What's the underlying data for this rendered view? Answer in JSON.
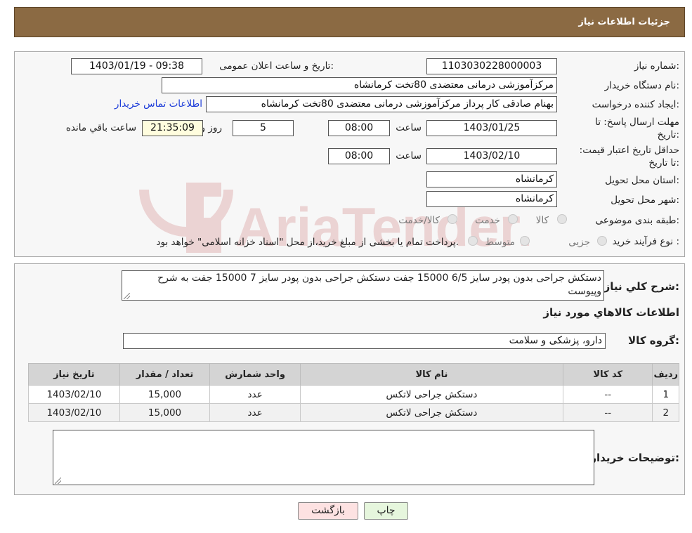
{
  "header": {
    "title": "جزئیات اطلاعات نیاز"
  },
  "watermark": {
    "text": "AriaTender.neT",
    "color": "#b02020"
  },
  "form": {
    "need_number": {
      "label": "شماره نیاز:",
      "value": "1103030228000003"
    },
    "announce": {
      "label": "تاریخ و ساعت اعلان عمومی:",
      "value": "1403/01/19 - 09:38"
    },
    "buyer_org": {
      "label": "نام دستگاه خریدار:",
      "value": "مرکزآموزشی درمانی معتضدی 80تخت کرمانشاه"
    },
    "requester": {
      "label": "ایجاد کننده درخواست:",
      "value": "بهنام صادقی کار پرداز مرکزآموزشی درمانی معتضدی 80تخت کرمانشاه",
      "contact_link": "اطلاعات تماس خریدار"
    },
    "deadline": {
      "label": "مهلت ارسال پاسخ: تا تاریخ:",
      "date": "1403/01/25",
      "time_label": "ساعت",
      "time": "08:00",
      "days": "5",
      "days_label": "روز و",
      "remaining": "21:35:09",
      "remaining_label": "ساعت باقي مانده"
    },
    "validity": {
      "label": "حداقل تاریخ اعتبار قیمت: تا تاریخ:",
      "date": "1403/02/10",
      "time_label": "ساعت",
      "time": "08:00"
    },
    "province": {
      "label": "استان محل تحویل:",
      "value": "کرمانشاه"
    },
    "city": {
      "label": "شهر محل تحویل:",
      "value": "کرمانشاه"
    },
    "category": {
      "label": "طبقه بندی موضوعی:",
      "options": [
        "کالا",
        "خدمت",
        "کالا/خدمت"
      ]
    },
    "process": {
      "label": "نوع فرآیند خرید :",
      "options": [
        "جزیی",
        "متوسط"
      ],
      "note": "پرداخت تمام یا بخشی از مبلغ خرید،از محل \"اسناد خزانه اسلامی\" خواهد بود."
    }
  },
  "description": {
    "label": "شرح کلي نياز:",
    "text": "دستکش جراحی بدون پودر سایز 6/5  15000 جفت   دستکش جراحی بدون پودر سایز 7   15000 جفت  به شرح وپیوست"
  },
  "goods": {
    "section_title": "اطلاعات کالاهاي مورد نياز",
    "group_label": "گروه کالا:",
    "group_value": "دارو، پزشکی و سلامت",
    "columns": [
      "رديف",
      "کد کالا",
      "نام کالا",
      "واحد شمارش",
      "تعداد / مقدار",
      "تاریخ نیاز"
    ],
    "rows": [
      {
        "idx": "1",
        "code": "--",
        "name": "دستکش جراحی لاتکس",
        "unit": "عدد",
        "qty": "15,000",
        "date": "1403/02/10"
      },
      {
        "idx": "2",
        "code": "--",
        "name": "دستکش جراحی لاتکس",
        "unit": "عدد",
        "qty": "15,000",
        "date": "1403/02/10"
      }
    ]
  },
  "buyer_notes": {
    "label": "توضیحات خریدار:",
    "value": ""
  },
  "buttons": {
    "print": "چاپ",
    "back": "بازگشت"
  }
}
